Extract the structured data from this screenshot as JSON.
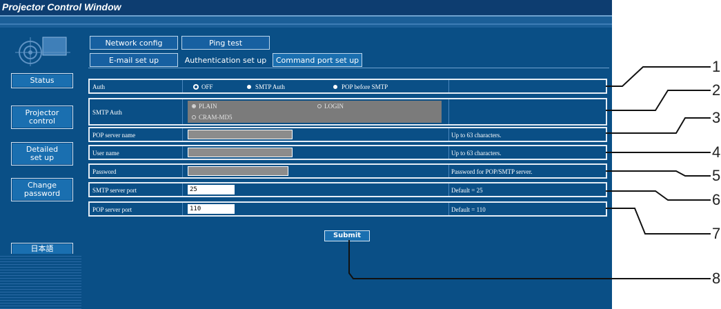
{
  "window": {
    "title": "Projector Control Window"
  },
  "sidebar": {
    "buttons": [
      {
        "label_lines": [
          "Status"
        ]
      },
      {
        "label_lines": [
          "Projector",
          "control"
        ]
      },
      {
        "label_lines": [
          "Detailed",
          "set up"
        ]
      },
      {
        "label_lines": [
          "Change",
          "password"
        ]
      },
      {
        "label_lines": [
          "日本語"
        ]
      }
    ]
  },
  "tabs": {
    "network_config": "Network config",
    "ping_test": "Ping test",
    "email_setup": "E-mail set up",
    "auth_setup": "Authentication set up",
    "command_port": "Command port set up"
  },
  "form": {
    "auth": {
      "label": "Auth",
      "options": [
        "OFF",
        "SMTP Auth",
        "POP before SMTP"
      ],
      "selected": "OFF"
    },
    "smtp_auth": {
      "label": "SMTP Auth",
      "options": [
        "PLAIN",
        "LOGIN",
        "CRAM-MD5"
      ],
      "selected": "PLAIN"
    },
    "pop_server_name": {
      "label": "POP server name",
      "value": "",
      "note": "Up to 63 characters."
    },
    "user_name": {
      "label": "User name",
      "value": "",
      "note": "Up to 63 characters."
    },
    "password": {
      "label": "Password",
      "value": "",
      "note": "Password for POP/SMTP server."
    },
    "smtp_port": {
      "label": "SMTP server port",
      "value": "25",
      "note": "Default = 25"
    },
    "pop_port": {
      "label": "POP server port",
      "value": "110",
      "note": "Default = 110"
    },
    "submit_label": "Submit"
  },
  "callouts": [
    "1",
    "2",
    "3",
    "4",
    "5",
    "6",
    "7",
    "8"
  ],
  "colors": {
    "window_bg": "#0a4f86",
    "title_bg": "#0d3d70",
    "button_bg": "#1a6fb0"
  }
}
